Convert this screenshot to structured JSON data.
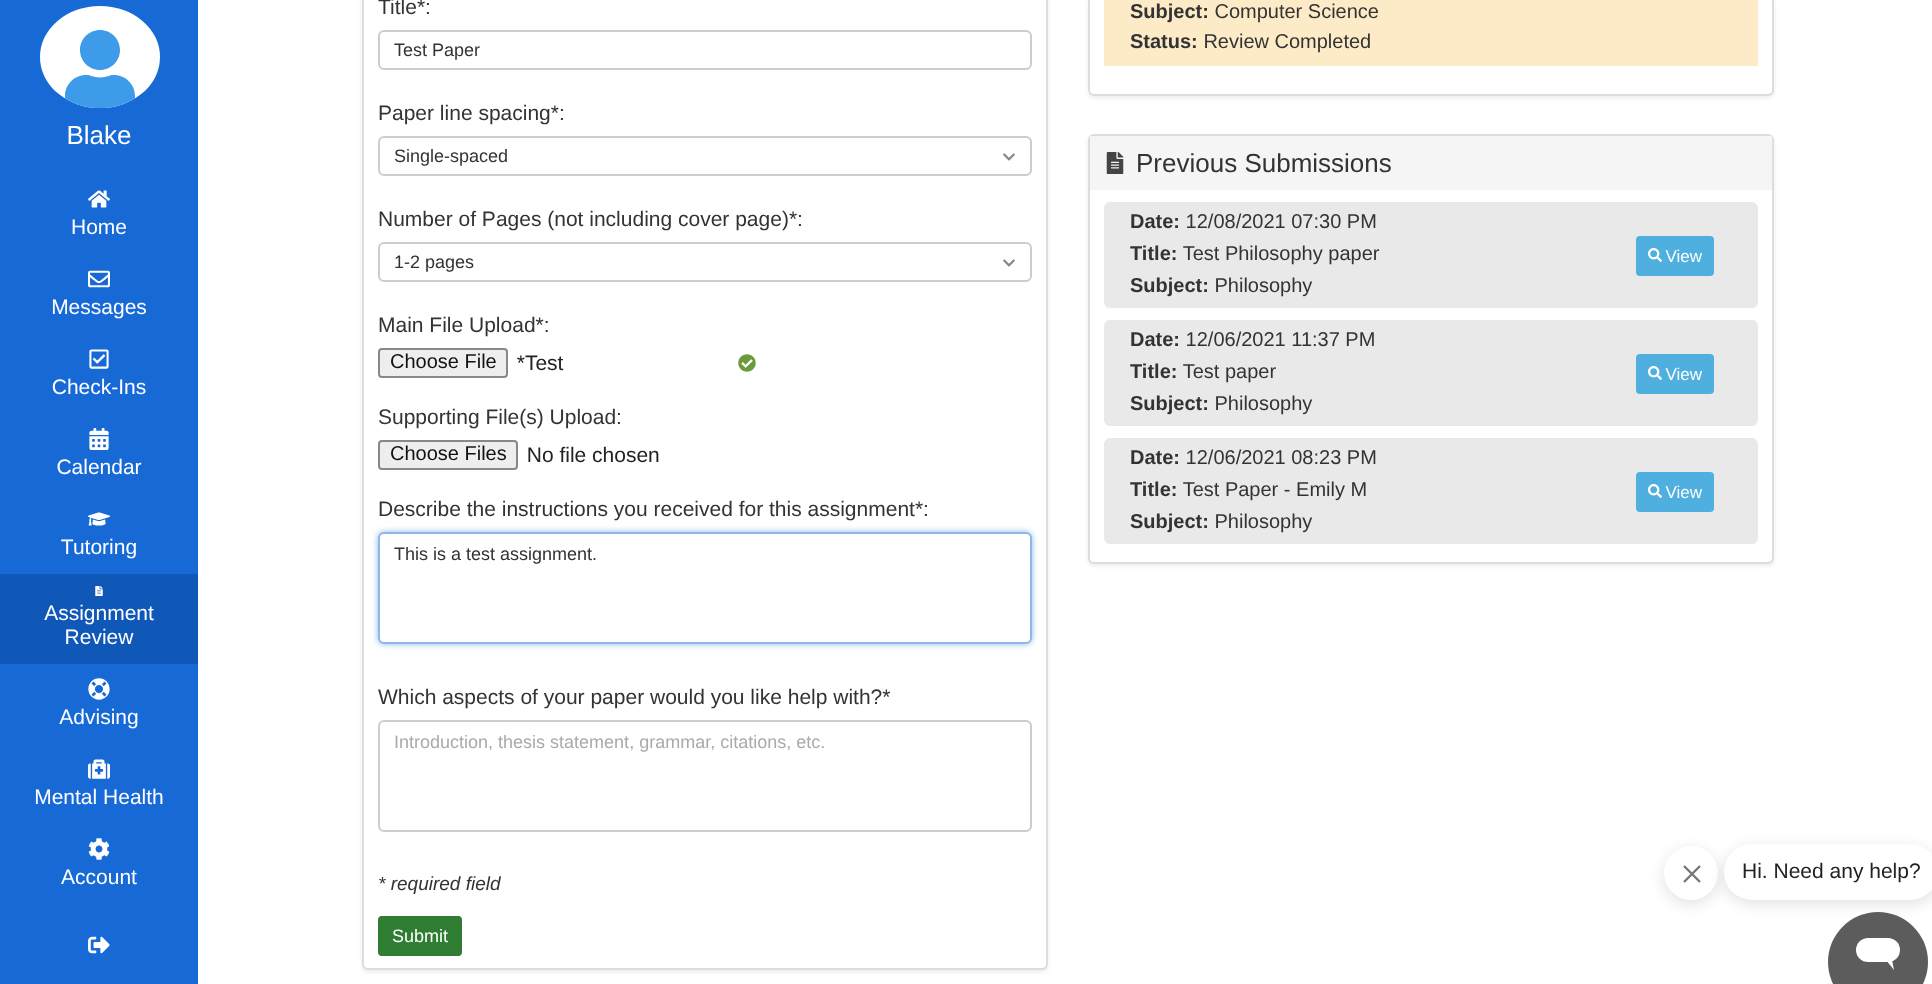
{
  "sidebar": {
    "user_name": "Blake",
    "items": [
      {
        "label": "Home",
        "selected": false
      },
      {
        "label": "Messages",
        "selected": false
      },
      {
        "label": "Check-Ins",
        "selected": false
      },
      {
        "label": "Calendar",
        "selected": false
      },
      {
        "label": "Tutoring",
        "selected": false
      },
      {
        "label": "Assignment Review",
        "selected": true
      },
      {
        "label": "Advising",
        "selected": false
      },
      {
        "label": "Mental Health",
        "selected": false
      },
      {
        "label": "Account",
        "selected": false
      },
      {
        "selected": false
      }
    ]
  },
  "form": {
    "fields": [
      {
        "kind": "text",
        "label": "Title*:",
        "value": "Test Paper"
      },
      {
        "kind": "select",
        "label": "Paper line spacing*:",
        "value": "Single-spaced"
      },
      {
        "kind": "select",
        "label": "Number of Pages (not including cover page)*:",
        "value": "1-2 pages"
      },
      {
        "kind": "file",
        "label": "Main File Upload*:",
        "button": "Choose File",
        "value": "*Test",
        "valid": true
      },
      {
        "kind": "file",
        "label": "Supporting File(s) Upload:",
        "button": "Choose Files",
        "value": "No file chosen",
        "valid": false
      },
      {
        "kind": "textarea",
        "label": "Describe the instructions you received for this assignment*:",
        "value": "This is a test assignment.",
        "focused": true
      },
      {
        "kind": "textarea",
        "label": "Which aspects of your paper would you like help with?*",
        "placeholder": "Introduction, thesis statement, grammar, citations, etc.",
        "focused": false
      }
    ],
    "note": "* required field",
    "submit": "Submit"
  },
  "current": {
    "lines": [
      {
        "label": "Subject:",
        "value": "Computer Science"
      },
      {
        "label": "Status:",
        "value": "Review Completed"
      }
    ]
  },
  "previous": {
    "title": "Previous Submissions",
    "items": [
      {
        "date_label": "Date:",
        "date": "12/08/2021 07:30 PM",
        "title_label": "Title:",
        "title": "Test Philosophy paper",
        "subject_label": "Subject:",
        "subject": "Philosophy",
        "button": "View"
      },
      {
        "date_label": "Date:",
        "date": "12/06/2021 11:37 PM",
        "title_label": "Title:",
        "title": "Test paper",
        "subject_label": "Subject:",
        "subject": "Philosophy",
        "button": "View"
      },
      {
        "date_label": "Date:",
        "date": "12/06/2021 08:23 PM",
        "title_label": "Title:",
        "title": "Test Paper - Emily M",
        "subject_label": "Subject:",
        "subject": "Philosophy",
        "button": "View"
      }
    ]
  },
  "chat": {
    "message": "Hi. Need any help?"
  }
}
